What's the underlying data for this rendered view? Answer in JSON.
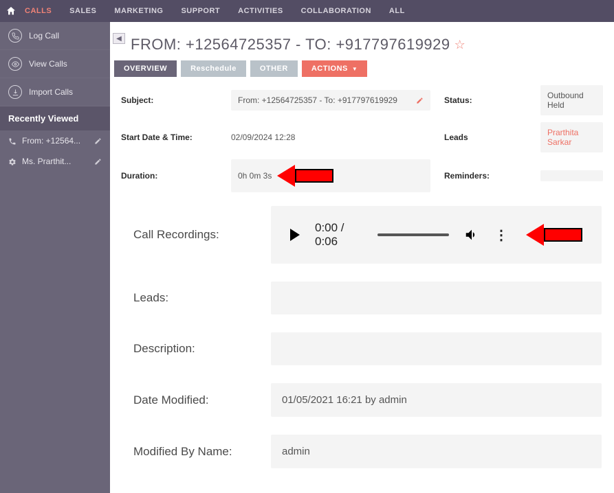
{
  "nav": {
    "items": [
      "CALLS",
      "SALES",
      "MARKETING",
      "SUPPORT",
      "ACTIVITIES",
      "COLLABORATION",
      "ALL"
    ],
    "active_index": 0
  },
  "sidebar": {
    "actions": [
      {
        "icon": "phone-log",
        "label": "Log Call"
      },
      {
        "icon": "eye",
        "label": "View Calls"
      },
      {
        "icon": "download",
        "label": "Import Calls"
      }
    ],
    "recent_header": "Recently Viewed",
    "recent": [
      {
        "icon": "phone",
        "label": "From: +12564..."
      },
      {
        "icon": "gear",
        "label": "Ms. Prarthit..."
      }
    ]
  },
  "page": {
    "title": "FROM: +12564725357 - TO: +917797619929"
  },
  "tabs": {
    "overview": "OVERVIEW",
    "reschedule": "Reschedule",
    "other": "OTHER",
    "actions": "ACTIONS"
  },
  "fields": {
    "subject_label": "Subject:",
    "subject_value": "From: +12564725357 - To: +917797619929",
    "status_label": "Status:",
    "status_value": "Outbound Held",
    "start_label": "Start Date & Time:",
    "start_value": "02/09/2024 12:28",
    "leads_label": "Leads",
    "leads_value": "Prarthita Sarkar",
    "duration_label": "Duration:",
    "duration_value": "0h 0m 3s",
    "reminders_label": "Reminders:"
  },
  "lower": {
    "recordings_label": "Call Recordings:",
    "audio_time": "0:00 / 0:06",
    "leads_label": "Leads:",
    "description_label": "Description:",
    "date_modified_label": "Date Modified:",
    "date_modified_value": "01/05/2021 16:21 by admin",
    "modified_by_label": "Modified By Name:",
    "modified_by_value": "admin"
  }
}
